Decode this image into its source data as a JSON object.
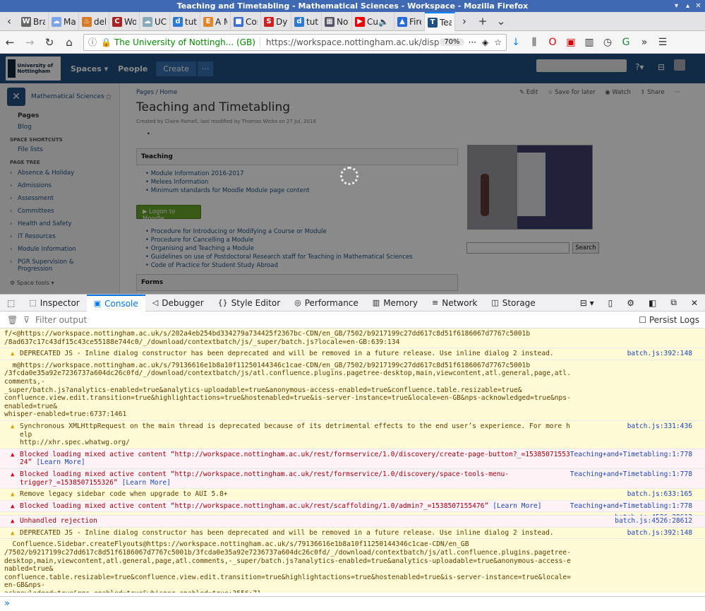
{
  "window": {
    "title": "Teaching and Timetabling - Mathematical Sciences - Workspace - Mozilla Firefox"
  },
  "tabs": [
    {
      "label": "Brain",
      "fav": "W",
      "color": "#666"
    },
    {
      "label": "Mach",
      "fav": "☁",
      "color": "#7aa6e8"
    },
    {
      "label": "debu",
      "fav": "♨",
      "color": "#d57c2a"
    },
    {
      "label": "Work",
      "fav": "C",
      "color": "#a22"
    },
    {
      "label": "UCLA RE",
      "fav": "☁",
      "color": "#8ab"
    },
    {
      "label": "tutori",
      "fav": "d",
      "color": "#2b7bd4"
    },
    {
      "label": "A Ma",
      "fav": "E",
      "color": "#e0862a"
    },
    {
      "label": "Cosyr",
      "fav": "■",
      "color": "#3b6fd0"
    },
    {
      "label": "Dyna",
      "fav": "S",
      "color": "#c22"
    },
    {
      "label": "tutori",
      "fav": "d",
      "color": "#2b7bd4"
    },
    {
      "label": "Nottir",
      "fav": "▦",
      "color": "#556"
    },
    {
      "label": "Cu",
      "fav": "▶",
      "color": "#e00"
    },
    {
      "label": "Firefo",
      "fav": "▲",
      "color": "#2a6ad8"
    },
    {
      "label": "Tea",
      "fav": "T",
      "color": "#205081"
    }
  ],
  "nav": {
    "secure": "The University of Nottingh... (GB)",
    "url": "https://workspace.nottingham.ac.uk/displ",
    "zoom": "70%"
  },
  "confluence": {
    "logo_text": "University of Nottingham",
    "spaces": "Spaces",
    "people": "People",
    "create": "Create",
    "space_name": "Mathematical Sciences",
    "pages": "Pages",
    "blog": "Blog",
    "shortcuts_head": "SPACE SHORTCUTS",
    "file_lists": "File lists",
    "tree_head": "PAGE TREE",
    "tree": [
      "Absence & Holiday",
      "Admissions",
      "Assessment",
      "Committees",
      "Health and Safety",
      "IT Resources",
      "Module Information",
      "PGR Supervision & Progression"
    ],
    "space_tools": "Space tools",
    "breadcrumb": "Pages  /  Home",
    "actions": {
      "edit": "Edit",
      "save": "Save for later",
      "watch": "Watch",
      "share": "Share"
    },
    "title": "Teaching and Timetabling",
    "byline": "Created by Claire Parnell, last modified by Thomas Wicks on 27 Jul, 2018",
    "teaching_head": "Teaching",
    "teaching_links": [
      "Module Information 2016-2017",
      "Melees Information",
      "Minimum standards for Moodle Module page content"
    ],
    "moodle_btn": "Logon to Moodle",
    "proc_links": [
      "Procedure for Introducing or Modifying a Course or Module",
      "Procedure for Cancelling a Module",
      "Organising and Teaching a Module",
      "Guidelines on use of Postdoctoral Research staff for Teaching in Mathematical Sciences",
      "Code of Practice for Student Study Abroad"
    ],
    "forms_head": "Forms",
    "search_btn": "Search"
  },
  "devtools": {
    "tabs": [
      "Inspector",
      "Console",
      "Debugger",
      "Style Editor",
      "Performance",
      "Memory",
      "Network",
      "Storage"
    ],
    "filter_placeholder": "Filter output",
    "persist": "Persist Logs",
    "messages": [
      {
        "type": "trace",
        "text": "f/<@https://workspace.nottingham.ac.uk/s/202a4eb254bd334279a734425f2367bc-CDN/en_GB/7502/b9217199c27dd617c8d51f6186067d7767c5001b\n/8ad637c17c43df15c43ce55188e744c0/_/download/contextbatch/js/_super/batch.js?locale=en-GB:639:134",
        "src": ""
      },
      {
        "type": "warn",
        "text": "DEPRECATED JS - Inline dialog constructor has been deprecated and will be removed in a future release. Use inline dialog 2 instead.",
        "src": "batch.js:392:148"
      },
      {
        "type": "trace",
        "text": "  m@https://workspace.nottingham.ac.uk/s/79136616e1b8a10f11250144346c1cae-CDN/en_GB/7502/b9217199c27dd617c8d51f6186067d7767c5001b\n/3fcda0e35a92e7236737a604dc26c0fd/_/download/contextbatch/js/atl.confluence.plugins.pagetree-desktop,main,viewcontent,atl.general,page,atl.comments,-\n_super/batch.js?analytics-enabled=true&analytics-uploadable=true&anonymous-access-enabled=true&confluence.table.resizable=true&\nconfluence.view.edit.transition=true&highlightactions=true&hostenabled=true&is-server-instance=true&locale=en-GB&nps-acknowledged=true&nps-enabled=true&\nwhisper-enabled=true:6737:1461",
        "src": ""
      },
      {
        "type": "warn",
        "text": "Synchronous XMLHttpRequest on the main thread is deprecated because of its detrimental effects to the end user’s experience. For more help\nhttp://xhr.spec.whatwg.org/",
        "src": "batch.js:331:436"
      },
      {
        "type": "err",
        "text": "Blocked loading mixed active content “http://workspace.nottingham.ac.uk/rest/formservice/1.0/discovery/create-page-button?_=1538507155324”",
        "src": "Teaching+and+Timetabling:1:778",
        "learn": "[Learn More]"
      },
      {
        "type": "err",
        "text": "Blocked loading mixed active content “http://workspace.nottingham.ac.uk/rest/formservice/1.0/discovery/space-tools-menu-\ntrigger?_=1538507155326”",
        "src": "Teaching+and+Timetabling:1:778",
        "learn": "[Learn More]"
      },
      {
        "type": "warn",
        "text": "Remove legacy sidebar code when upgrade to AUI 5.8+",
        "src": "batch.js:633:165"
      },
      {
        "type": "err",
        "text": "Blocked loading mixed active content “http://workspace.nottingham.ac.uk/rest/scaffolding/1.0/admin?_=1538507155476”",
        "src": "Teaching+and+Timetabling:1:778",
        "learn": "[Learn More]"
      },
      {
        "type": "warn",
        "text": "",
        "src": "batch.js:4526:28612"
      },
      {
        "type": "err",
        "text": "Unhandled rejection",
        "src": "batch.js:4526:28612"
      },
      {
        "type": "warn",
        "text": "DEPRECATED JS - Inline dialog constructor has been deprecated and will be removed in a future release. Use inline dialog 2 instead.",
        "src": "batch.js:392:148"
      },
      {
        "type": "trace",
        "text": "  Confluence.Sidebar.createFlyouts@https://workspace.nottingham.ac.uk/s/79136616e1b8a10f11250144346c1cae-CDN/en_GB\n/7502/b9217199c27dd617c8d51f6186067d7767c5001b/3fcda0e35a92e7236737a604dc26c0fd/_/download/contextbatch/js/atl.confluence.plugins.pagetree-\ndesktop,main,viewcontent,atl.general,page,atl.comments,-_super/batch.js?analytics-enabled=true&analytics-uploadable=true&anonymous-access-enabled=true&\nconfluence.table.resizable=true&confluence.view.edit.transition=true&highlightactions=true&hostenabled=true&is-server-instance=true&locale=en-GB&nps-\nacknowledged=true&nps-enabled=true&whisper-enabled=true:3556:71",
        "src": ""
      },
      {
        "type": "warn",
        "text": "DEPRECATED JS - Inline dialog constructor has been deprecated and will be removed in a future release. Use inline dialog 2 instead.",
        "src": "batch.js:392:148"
      }
    ],
    "prompt": "»"
  }
}
